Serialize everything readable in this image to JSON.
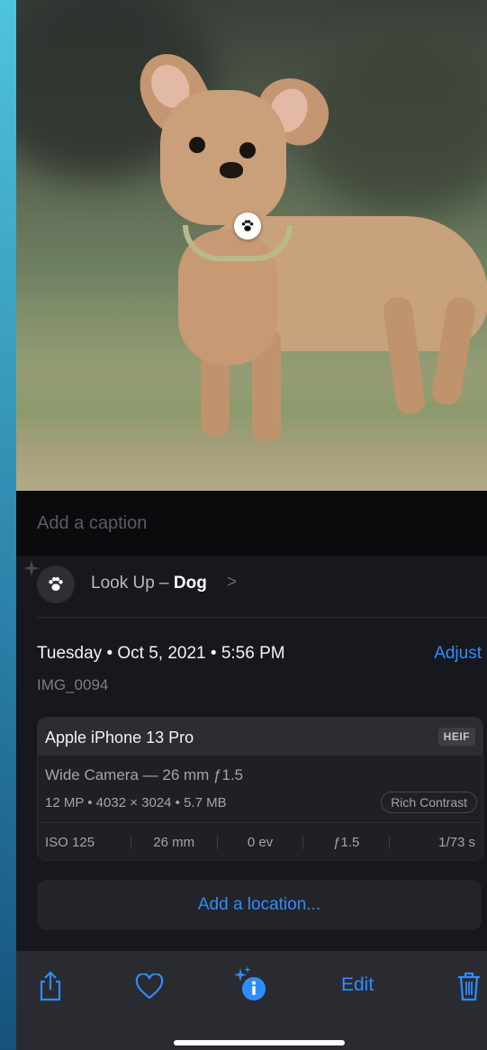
{
  "photo": {
    "subject": "Dog"
  },
  "caption": {
    "placeholder": "Add a caption"
  },
  "lookup": {
    "prefix": "Look Up – ",
    "subject": "Dog",
    "chevron": ">"
  },
  "info": {
    "date": "Tuesday • Oct 5, 2021 • 5:56 PM",
    "adjust_label": "Adjust",
    "filename": "IMG_0094"
  },
  "camera": {
    "device": "Apple iPhone 13 Pro",
    "format": "HEIF",
    "lens": "Wide Camera — 26 mm ƒ1.5",
    "specs": "12 MP  •  4032 × 3024  •  5.7 MB",
    "style": "Rich Contrast",
    "exif": [
      "ISO 125",
      "26 mm",
      "0 ev",
      "ƒ1.5",
      "1/73 s"
    ]
  },
  "location": {
    "label": "Add a location..."
  },
  "toolbar": {
    "share_icon": "share-icon",
    "favorite_icon": "heart-icon",
    "info_icon": "info-sparkle-icon",
    "edit_label": "Edit",
    "delete_icon": "trash-icon"
  },
  "colors": {
    "accent": "#2f8cff",
    "panel": "#17181d",
    "toolbar": "#2a2b31"
  }
}
